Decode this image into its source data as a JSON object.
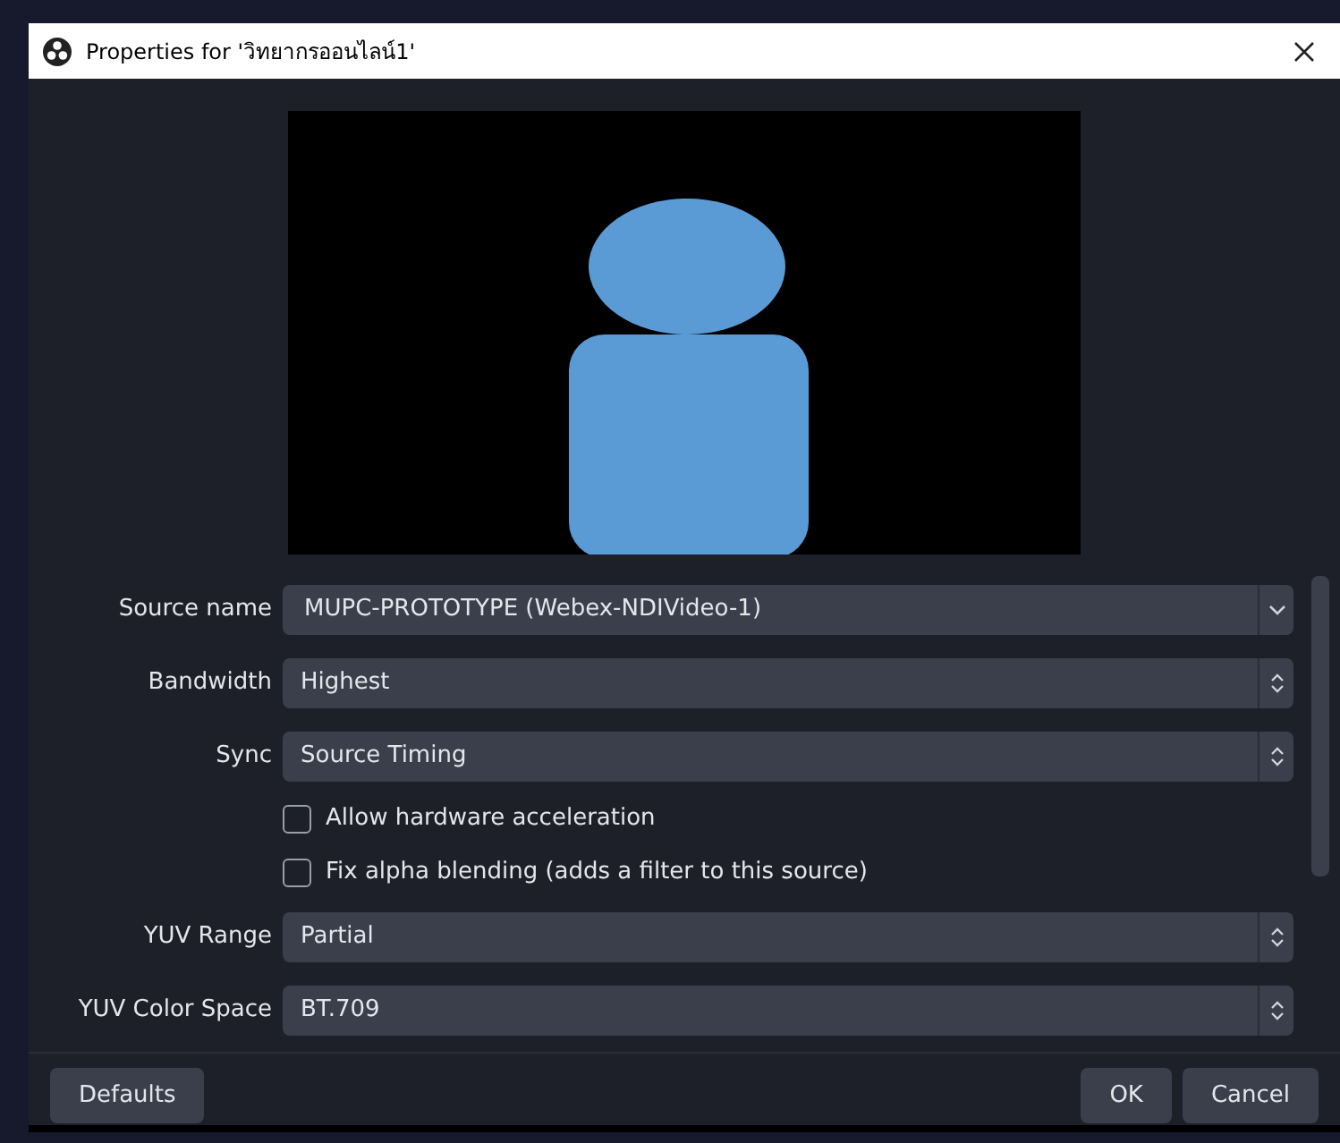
{
  "window": {
    "title": "Properties for 'วิทยากรออนไลน์1'"
  },
  "fields": [
    {
      "kind": "combo",
      "label": "Source name",
      "value": "MUPC-PROTOTYPE (Webex-NDIVideo-1)"
    },
    {
      "kind": "select",
      "label": "Bandwidth",
      "value": "Highest"
    },
    {
      "kind": "select",
      "label": "Sync",
      "value": "Source Timing"
    },
    {
      "kind": "checkbox",
      "label": "Allow hardware acceleration",
      "checked": false
    },
    {
      "kind": "checkbox",
      "label": "Fix alpha blending (adds a filter to this source)",
      "checked": false
    },
    {
      "kind": "select",
      "label": "YUV Range",
      "value": "Partial"
    },
    {
      "kind": "select",
      "label": "YUV Color Space",
      "value": "BT.709"
    }
  ],
  "buttons": {
    "left": [
      "Defaults"
    ],
    "right": [
      "OK",
      "Cancel"
    ]
  }
}
